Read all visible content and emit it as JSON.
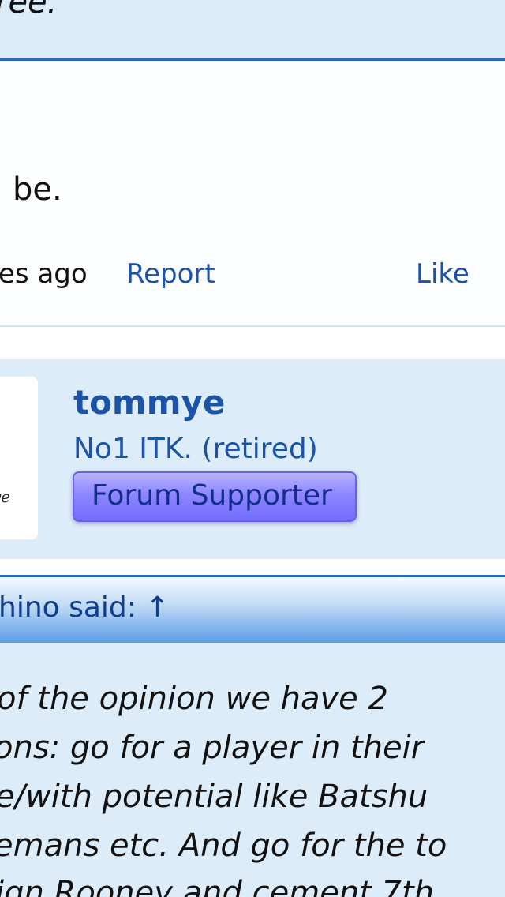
{
  "previous_post": {
    "quote_tail": "ree.",
    "message_tail": "be.",
    "time_fragment": "es ago",
    "report_label": "Report",
    "like_label": "Like"
  },
  "member": {
    "avatar_signature": "ye",
    "username": "tommye",
    "title": "No1 ITK. (retired)",
    "badge": "Forum Supporter"
  },
  "quote": {
    "author_label": "hino said: ↑",
    "lines": [
      "of the opinion we have 2",
      "ons: go for a player in their",
      "e/with potential like Batshu",
      "emans etc. And go for the to",
      "ign Rooney and cement 7th"
    ]
  },
  "colors": {
    "link": "#1b53a8",
    "header_bg": "#dcecf9",
    "accent_border": "#2a6bbf",
    "badge": "#8d86ff"
  }
}
